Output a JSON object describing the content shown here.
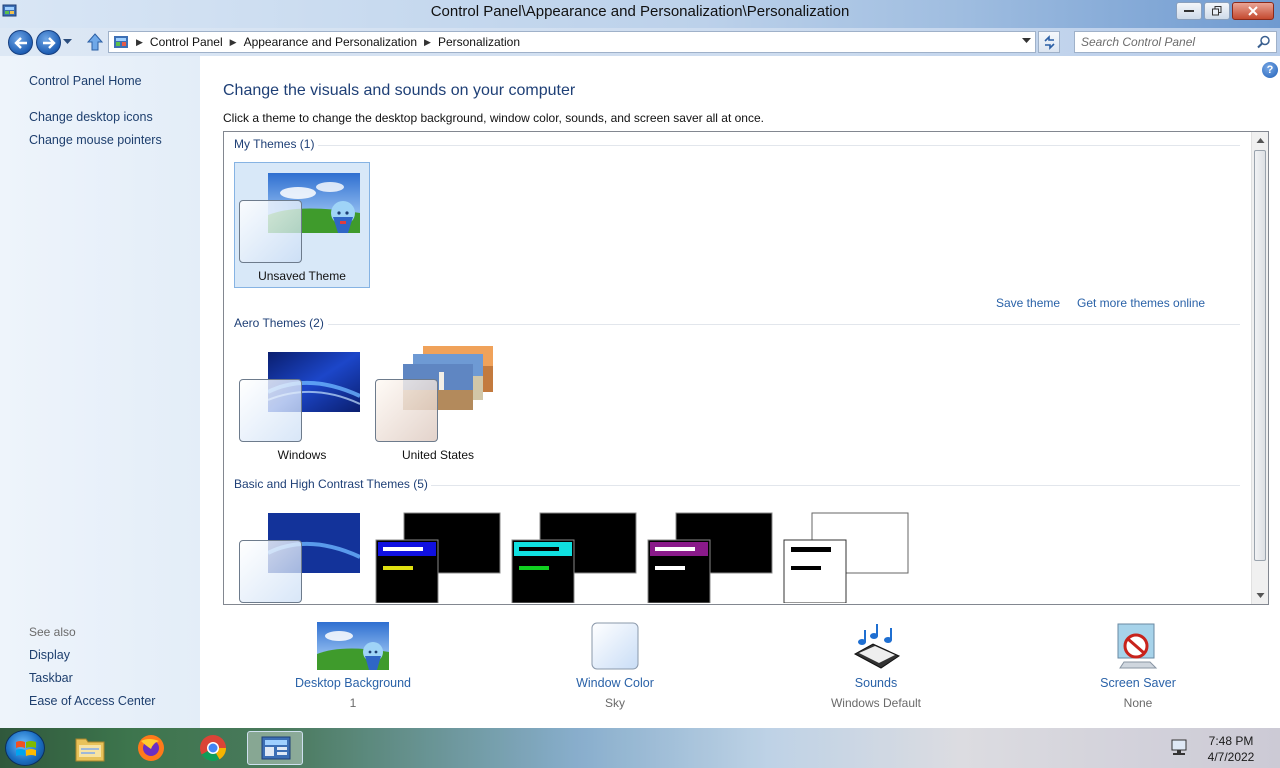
{
  "window": {
    "title": "Control Panel\\Appearance and Personalization\\Personalization"
  },
  "address": {
    "crumbs": [
      "Control Panel",
      "Appearance and Personalization",
      "Personalization"
    ],
    "search_placeholder": "Search Control Panel"
  },
  "sidebar": {
    "links": [
      "Control Panel Home",
      "Change desktop icons",
      "Change mouse pointers"
    ],
    "see_also_label": "See also",
    "see_also": [
      "Display",
      "Taskbar",
      "Ease of Access Center"
    ]
  },
  "main": {
    "heading": "Change the visuals and sounds on your computer",
    "subheading": "Click a theme to change the desktop background, window color, sounds, and screen saver all at once.",
    "groups": [
      {
        "label": "My Themes (1)",
        "themes": [
          "Unsaved Theme"
        ]
      },
      {
        "label": "Aero Themes (2)",
        "themes": [
          "Windows",
          "United States"
        ]
      },
      {
        "label": "Basic and High Contrast Themes (5)",
        "themes": []
      }
    ],
    "save_theme": "Save theme",
    "get_more": "Get more themes online"
  },
  "bottom": [
    {
      "label": "Desktop Background",
      "value": "1",
      "icon": "desktop-background-icon"
    },
    {
      "label": "Window Color",
      "value": "Sky",
      "icon": "window-color-icon"
    },
    {
      "label": "Sounds",
      "value": "Windows Default",
      "icon": "sounds-icon"
    },
    {
      "label": "Screen Saver",
      "value": "None",
      "icon": "screen-saver-icon"
    }
  ],
  "taskbar": {
    "time": "7:48 PM",
    "date": "4/7/2022",
    "apps": [
      "start-orb-icon",
      "file-explorer-icon",
      "firefox-icon",
      "chrome-icon",
      "control-panel-icon"
    ]
  },
  "colors": {
    "link": "#2a62a8",
    "heading": "#1e3f76",
    "selection": "#d8e8f8"
  }
}
